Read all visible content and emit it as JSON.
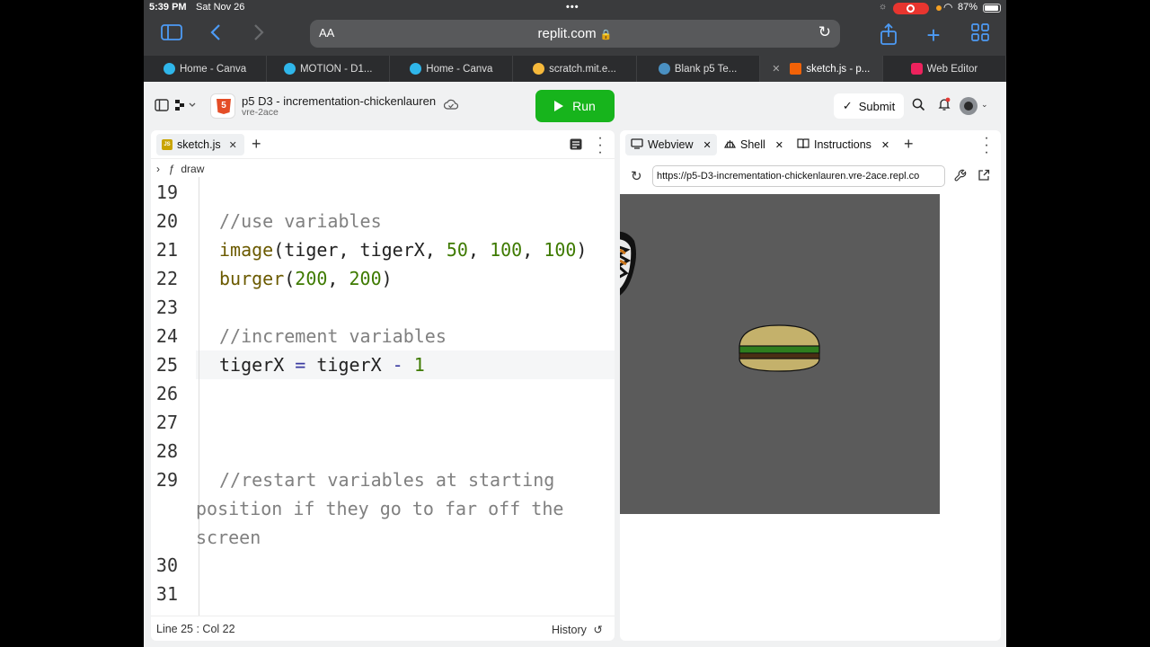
{
  "status_bar": {
    "time": "5:39 PM",
    "date": "Sat Nov 26",
    "battery": "87%"
  },
  "browser": {
    "address_aa": "AA",
    "address_url": "replit.com",
    "tabs": [
      {
        "label": "Home - Canva",
        "favicon_color": "#2fb6ea"
      },
      {
        "label": "MOTION - D1...",
        "favicon_color": "#2fb6ea"
      },
      {
        "label": "Home - Canva",
        "favicon_color": "#2fb6ea"
      },
      {
        "label": "scratch.mit.e...",
        "favicon_color": "#f6b93b"
      },
      {
        "label": "Blank p5 Te...",
        "favicon_color": "#4a90c2"
      },
      {
        "label": "sketch.js - p...",
        "favicon_color": "#f26207",
        "active": true
      },
      {
        "label": "Web Editor",
        "favicon_color": "#ed225d"
      }
    ]
  },
  "replit": {
    "project_title": "p5 D3 - incrementation-chickenlauren",
    "project_subtitle": "vre-2ace",
    "run_label": "Run",
    "submit_label": "Submit"
  },
  "editor": {
    "file_tab": "sketch.js",
    "breadcrumb_fn": "ƒ",
    "breadcrumb_label": "draw",
    "status_position": "Line 25 : Col 22",
    "history_label": "History",
    "lines": [
      {
        "n": "19"
      },
      {
        "n": "20",
        "comment": "//use variables"
      },
      {
        "n": "21",
        "fn": "image",
        "a1": "(tiger, tigerX, ",
        "num1": "50",
        "c1": ", ",
        "num2": "100",
        "c2": ", ",
        "num3": "100",
        "end": ")"
      },
      {
        "n": "22",
        "fn": "burger",
        "a1": "(",
        "num1": "200",
        "c1": ", ",
        "num2": "200",
        "end": ")"
      },
      {
        "n": "23"
      },
      {
        "n": "24",
        "comment": "//increment variables"
      },
      {
        "n": "25",
        "lhs": "tigerX ",
        "op1": "=",
        "rhs": " tigerX ",
        "op2": "-",
        "num": " 1"
      },
      {
        "n": "26"
      },
      {
        "n": "27"
      },
      {
        "n": "28"
      },
      {
        "n": "29",
        "comment": "//restart variables at starting",
        "cont1": "position if they go to far off the",
        "cont2": "screen"
      },
      {
        "n": "30"
      },
      {
        "n": "31"
      }
    ]
  },
  "webview": {
    "tabs": [
      "Webview",
      "Shell",
      "Instructions"
    ],
    "url": "https://p5-D3-incrementation-chickenlauren.vre-2ace.repl.co",
    "canvas_bg": "#5b5b5b"
  }
}
